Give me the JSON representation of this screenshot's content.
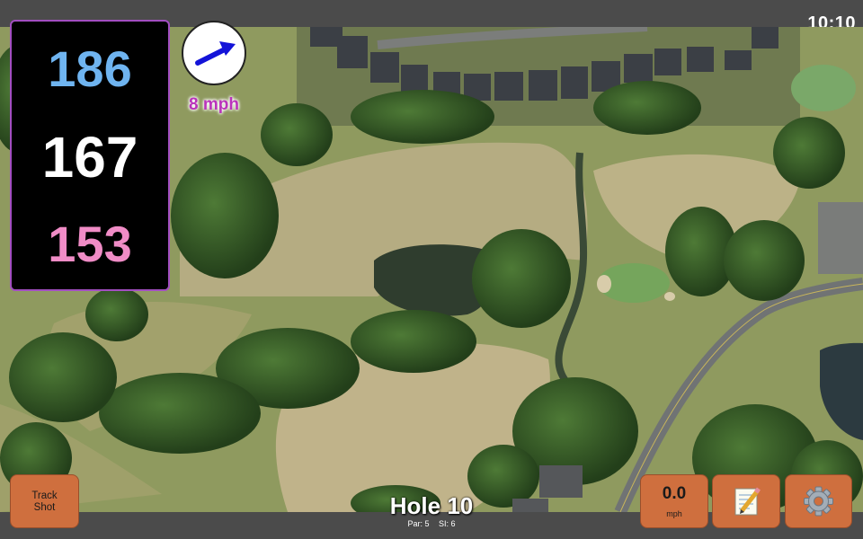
{
  "clock": "10:10",
  "yardages": {
    "back": "186",
    "middle": "167",
    "front": "153"
  },
  "wind": {
    "speed_label": "8 mph",
    "arrow_icon": "wind-arrow-icon"
  },
  "buttons": {
    "track_shot": {
      "line1": "Track",
      "line2": "Shot"
    },
    "speed": {
      "value": "0.0",
      "unit": "mph"
    },
    "notes_icon": "notepad-icon",
    "settings_icon": "gear-icon"
  },
  "hole": {
    "title": "Hole 10",
    "par": "Par: 5",
    "si": "SI: 6"
  },
  "colors": {
    "back_yardage": "#6fb4f0",
    "middle_yardage": "#ffffff",
    "front_yardage": "#f08cc6",
    "button_orange": "#cf6f3e",
    "panel_border": "#a24ec1"
  }
}
